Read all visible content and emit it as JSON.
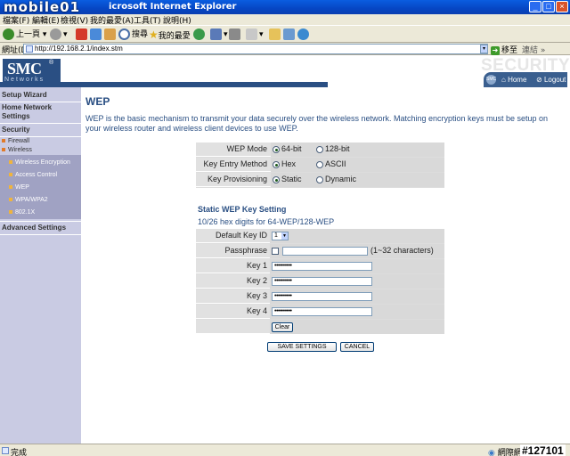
{
  "window": {
    "watermark_logo": "mobile01",
    "title": "icrosoft Internet Explorer"
  },
  "menu": [
    "檔案(F)",
    "編輯(E)",
    "檢視(V)",
    "我的最愛(A)",
    "工具(T)",
    "說明(H)"
  ],
  "toolbar": {
    "back": "上一頁",
    "search": "搜尋",
    "favorites": "我的最愛"
  },
  "address": {
    "label": "網址(D)",
    "url": "http://192.168.2.1/index.stm",
    "go": "移至",
    "links": "連結"
  },
  "header": {
    "logo": "SMC",
    "logo_reg": "®",
    "logo_sub": "Networks",
    "section": "SECURITY",
    "home": "Home",
    "logout": "Logout"
  },
  "sidebar": {
    "setup_wizard": "Setup Wizard",
    "home_network_1": "Home Network",
    "home_network_2": "Settings",
    "security": "Security",
    "firewall": "Firewall",
    "wireless": "Wireless",
    "items": [
      "Wireless Encryption",
      "Access Control",
      "WEP",
      "WPA/WPA2",
      "802.1X"
    ],
    "advanced": "Advanced Settings"
  },
  "main": {
    "title": "WEP",
    "intro": "WEP is the basic mechanism to transmit your data securely over the wireless network. Matching encryption keys must be setup on your wireless router and wireless client devices to use WEP.",
    "wep_mode": {
      "label": "WEP Mode",
      "opt1": "64-bit",
      "opt2": "128-bit",
      "selected": 1
    },
    "key_entry": {
      "label": "Key Entry Method",
      "opt1": "Hex",
      "opt2": "ASCII",
      "selected": 1
    },
    "key_prov": {
      "label": "Key Provisioning",
      "opt1": "Static",
      "opt2": "Dynamic",
      "selected": 1
    },
    "static_title": "Static WEP Key Setting",
    "hex_hint": "10/26 hex digits for 64-WEP/128-WEP",
    "default_key": {
      "label": "Default Key ID",
      "value": "1"
    },
    "passphrase": {
      "label": "Passphrase",
      "value": "",
      "hint": "(1~32 characters)"
    },
    "keys": [
      {
        "label": "Key 1",
        "value": "••••••••••"
      },
      {
        "label": "Key 2",
        "value": "••••••••••"
      },
      {
        "label": "Key 3",
        "value": "••••••••••"
      },
      {
        "label": "Key 4",
        "value": "••••••••••"
      }
    ],
    "clear": "Clear",
    "save": "SAVE SETTINGS",
    "cancel": "CANCEL"
  },
  "status": {
    "done": "完成",
    "zone": "網際網",
    "watermark_id": "#127101"
  }
}
